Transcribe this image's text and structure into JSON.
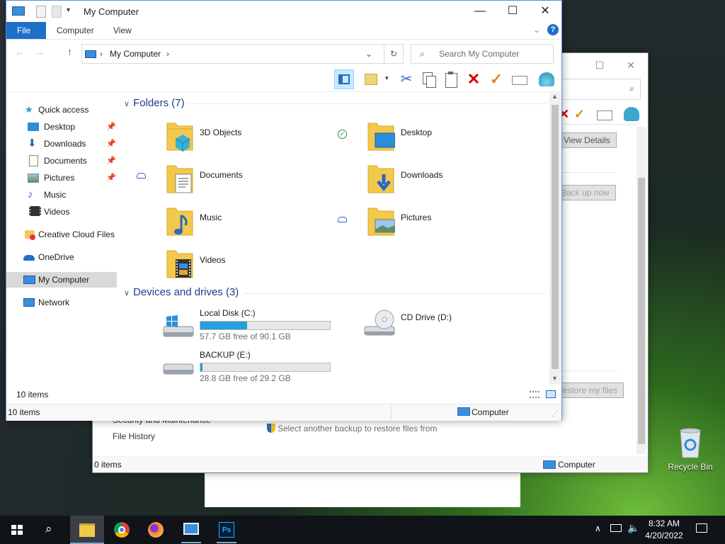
{
  "main_window": {
    "title": "My Computer",
    "ribbon_tabs": [
      "File",
      "Computer",
      "View"
    ],
    "address": {
      "crumb": "My Computer"
    },
    "search_placeholder": "Search My Computer",
    "nav": {
      "quick_access": "Quick access",
      "items": [
        {
          "label": "Desktop",
          "pinned": true
        },
        {
          "label": "Downloads",
          "pinned": true
        },
        {
          "label": "Documents",
          "pinned": true
        },
        {
          "label": "Pictures",
          "pinned": true
        },
        {
          "label": "Music",
          "pinned": false
        },
        {
          "label": "Videos",
          "pinned": false
        }
      ],
      "creative_cloud": "Creative Cloud Files",
      "onedrive": "OneDrive",
      "my_computer": "My Computer",
      "network": "Network"
    },
    "folders_header": "Folders (7)",
    "folders": [
      {
        "name": "3D Objects"
      },
      {
        "name": "Desktop"
      },
      {
        "name": "Documents"
      },
      {
        "name": "Downloads"
      },
      {
        "name": "Music"
      },
      {
        "name": "Pictures"
      },
      {
        "name": "Videos"
      }
    ],
    "drives_header": "Devices and drives (3)",
    "drives": [
      {
        "name": "Local Disk (C:)",
        "free_text": "57.7 GB free of 90.1 GB",
        "used_fraction": 0.36
      },
      {
        "name": "CD Drive (D:)"
      },
      {
        "name": "BACKUP (E:)",
        "free_text": "28.8 GB free of 29.2 GB",
        "used_fraction": 0.014
      }
    ],
    "inner_status": "10 items",
    "status_left": "10 items",
    "status_right": "Computer"
  },
  "background_window": {
    "view_details": "View Details",
    "back_up_now": "Back up now",
    "restore_files": "Restore my files",
    "security": "Security and Maintenance",
    "file_history": "File History",
    "select_backup": "Select another backup to restore files from",
    "status_left": "0 items",
    "status_right": "Computer"
  },
  "desktop": {
    "recycle_bin": "Recycle Bin"
  },
  "taskbar": {
    "time": "8:32 AM",
    "date": "4/20/2022"
  },
  "colors": {
    "accent": "#1e6fc8",
    "drive_fill": "#26a0da",
    "group_header": "#1e3d8c"
  }
}
